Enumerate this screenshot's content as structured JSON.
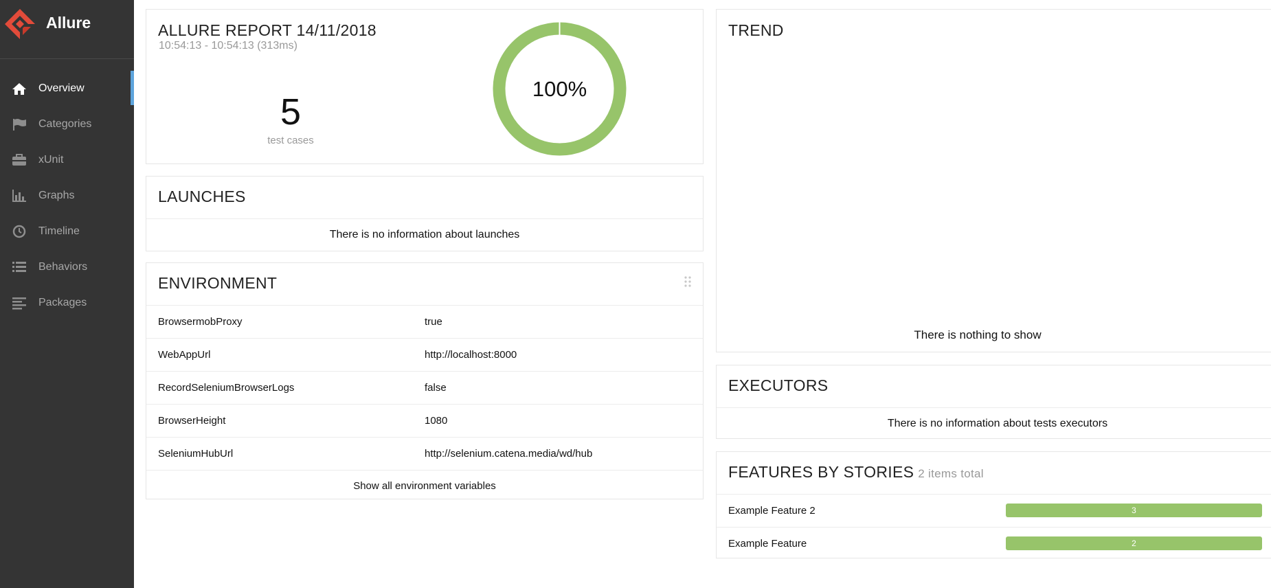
{
  "app": {
    "name": "Allure"
  },
  "colors": {
    "sidebar_bg": "#343434",
    "accent": "#5ea4dc",
    "passed": "#97c46a",
    "logo": "#e24b3a"
  },
  "sidebar": {
    "items": [
      {
        "label": "Overview",
        "icon": "home-icon",
        "active": true
      },
      {
        "label": "Categories",
        "icon": "flag-icon",
        "active": false
      },
      {
        "label": "xUnit",
        "icon": "briefcase-icon",
        "active": false
      },
      {
        "label": "Graphs",
        "icon": "bar-chart-icon",
        "active": false
      },
      {
        "label": "Timeline",
        "icon": "clock-icon",
        "active": false
      },
      {
        "label": "Behaviors",
        "icon": "list-icon",
        "active": false
      },
      {
        "label": "Packages",
        "icon": "align-left-icon",
        "active": false
      }
    ]
  },
  "summary": {
    "title": "ALLURE REPORT 14/11/2018",
    "time": "10:54:13 - 10:54:13 (313ms)",
    "count": "5",
    "count_label": "test cases",
    "percent_text": "100%",
    "pass_fraction": 1.0
  },
  "launches": {
    "title": "LAUNCHES",
    "empty": "There is no information about launches"
  },
  "environment": {
    "title": "ENVIRONMENT",
    "rows": [
      {
        "key": "BrowsermobProxy",
        "value": "true"
      },
      {
        "key": "WebAppUrl",
        "value": "http://localhost:8000"
      },
      {
        "key": "RecordSeleniumBrowserLogs",
        "value": "false"
      },
      {
        "key": "BrowserHeight",
        "value": "1080"
      },
      {
        "key": "SeleniumHubUrl",
        "value": "http://selenium.catena.media/wd/hub"
      }
    ],
    "show_all": "Show all environment variables"
  },
  "trend": {
    "title": "TREND",
    "empty": "There is nothing to show"
  },
  "executors": {
    "title": "EXECUTORS",
    "empty": "There is no information about tests executors"
  },
  "features": {
    "title": "FEATURES BY STORIES",
    "total": "2 items total",
    "rows": [
      {
        "name": "Example Feature 2",
        "value": "3",
        "fraction": 1.0
      },
      {
        "name": "Example Feature",
        "value": "2",
        "fraction": 1.0
      }
    ]
  }
}
